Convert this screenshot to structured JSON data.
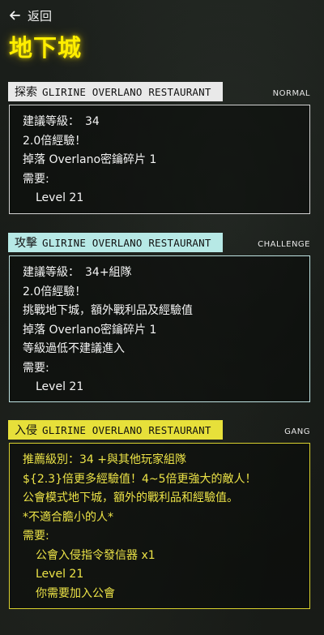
{
  "nav": {
    "back_label": "返回",
    "back_icon": "arrow-left-icon"
  },
  "page": {
    "title": "地下城"
  },
  "colors": {
    "title": "#ffee00",
    "normal_header": "#e9e9e9",
    "challenge_header": "#b7e9e6",
    "gang_header": "#e7e03a",
    "gang_text": "#ece347"
  },
  "modes": {
    "normal": {
      "verb": "探索",
      "location": "GLIRINE OVERLANO RESTAURANT",
      "tag": "NORMAL",
      "lines": [
        "建議等級：　34",
        "2.0倍經驗！",
        "掉落 Overlano密鑰碎片 1",
        "需要:",
        "Level 21"
      ]
    },
    "challenge": {
      "verb": "攻擊",
      "location": "GLIRINE OVERLANO RESTAURANT",
      "tag": "CHALLENGE",
      "lines": [
        "建議等級：　34+組隊",
        "2.0倍經驗！",
        "挑戰地下城，額外戰利品及經驗值",
        "掉落 Overlano密鑰碎片 1",
        "等級過低不建議進入",
        "需要:",
        "Level 21"
      ]
    },
    "gang": {
      "verb": "入侵",
      "location": "GLIRINE OVERLANO RESTAURANT",
      "tag": "GANG",
      "lines": [
        "推薦級別：34 +與其他玩家組隊",
        "${2.3}倍更多經驗值！4~5倍更強大的敵人！",
        "公會模式地下城，額外的戰利品和經驗值。",
        "*不適合膽小的人*",
        "需要:",
        "公會入侵指令發信器 x1",
        "Level 21",
        "你需要加入公會"
      ]
    }
  }
}
